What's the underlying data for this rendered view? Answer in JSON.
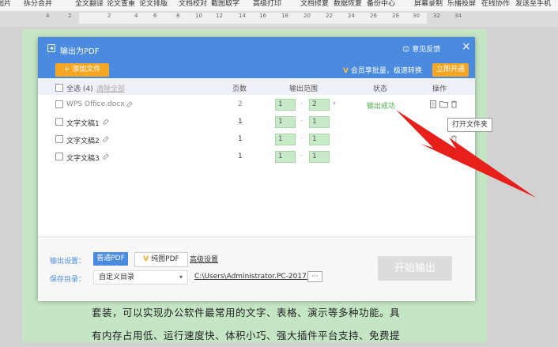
{
  "toolbar": {
    "items": [
      "图片",
      "拆分合并",
      "全文翻译",
      "论文查重",
      "论文排版",
      "文档校对",
      "截图取字",
      "高级打印",
      "文档修复",
      "数据恢复",
      "备份中心",
      "屏幕录制",
      "乐播投屏",
      "在线协作",
      "发送至手机"
    ]
  },
  "ruler": {
    "ticks": [
      "4",
      "2",
      "2",
      "4",
      "6",
      "8",
      "10",
      "12",
      "14",
      "16",
      "18",
      "20",
      "22",
      "24",
      "26",
      "28",
      "30",
      "32",
      "34"
    ]
  },
  "dialog": {
    "title": "输出为PDF",
    "feedback_label": "意见反馈",
    "close_glyph": "×",
    "add_file_label": "+ 添加文件",
    "promo_text": "会员享批量，极速转换",
    "open_vip_label": "立即开通",
    "table": {
      "select_all_label": "全选 (4)",
      "clear_all_label": "清除全部",
      "col_pages": "页数",
      "col_range": "输出范围",
      "col_status": "状态",
      "col_ops": "操作",
      "rows": [
        {
          "name": "WPS Office.docx",
          "pages": "2",
          "from": "1",
          "to": "2",
          "status": "输出成功"
        },
        {
          "name": "文字文稿1",
          "pages": "1",
          "from": "1",
          "to": "1",
          "status": ""
        },
        {
          "name": "文字文稿2",
          "pages": "1",
          "from": "1",
          "to": "1",
          "status": ""
        },
        {
          "name": "文字文稿3",
          "pages": "1",
          "from": "1",
          "to": "1",
          "status": ""
        }
      ]
    },
    "footer": {
      "output_settings_label": "输出设置：",
      "mode_normal": "普通PDF",
      "mode_pure": "纯图PDF",
      "advanced_label": "高级设置",
      "save_dir_label": "保存目录：",
      "save_dir_value": "自定义目录",
      "save_path": "C:\\Users\\Administrator.PC-20171",
      "more_glyph": "···",
      "start_label": "开始输出"
    }
  },
  "tooltip": "打开文件夹",
  "document": {
    "line1": "套装，可以实现办公软件最常用的文字、表格、演示等多种功能。具",
    "line2": "有内存占用低、运行速度快、体积小巧、强大插件平台支持、免费提"
  },
  "colors": {
    "dialog_blue": "#4a8be0",
    "accent_orange": "#f5a623",
    "success_green": "#4caf50",
    "arrow_red": "#e8201c",
    "page_green": "#c5e6c5"
  }
}
